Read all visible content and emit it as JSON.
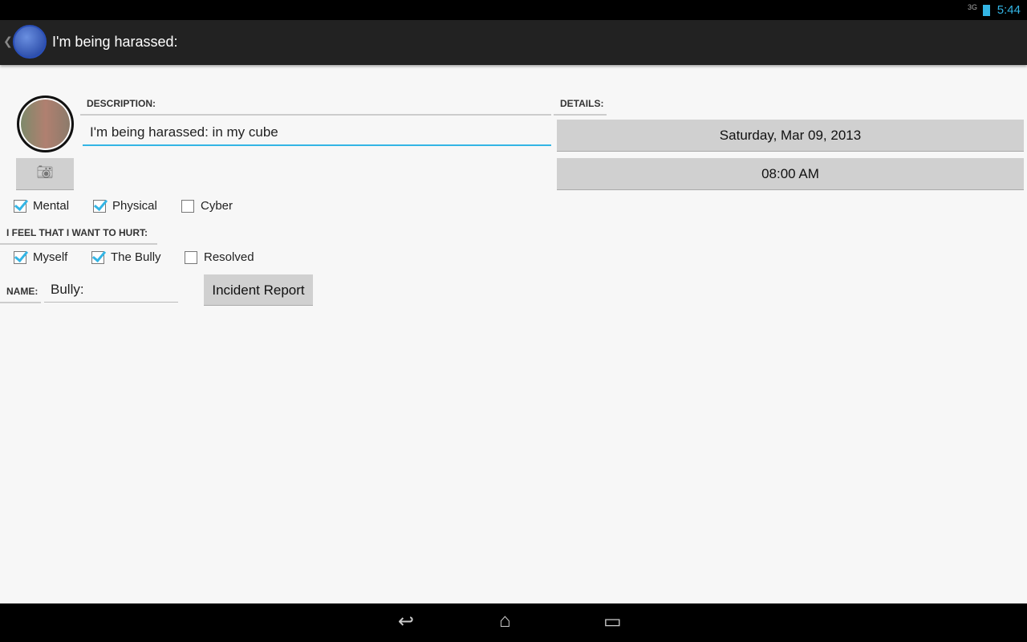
{
  "status_bar": {
    "network": "3G",
    "time": "5:44"
  },
  "action_bar": {
    "title": "I'm being harassed:"
  },
  "form": {
    "description_label": "DESCRIPTION:",
    "description_value": "I'm being harassed: in my cube",
    "details_label": "DETAILS:",
    "date": "Saturday, Mar 09, 2013",
    "time": "08:00 AM",
    "types": [
      {
        "label": "Mental",
        "checked": true
      },
      {
        "label": "Physical",
        "checked": true
      },
      {
        "label": "Cyber",
        "checked": false
      }
    ],
    "hurt_label": "I FEEL THAT I WANT TO HURT:",
    "hurt": [
      {
        "label": "Myself",
        "checked": true
      },
      {
        "label": "The Bully",
        "checked": true
      },
      {
        "label": "Resolved",
        "checked": false
      }
    ],
    "name_label": "NAME:",
    "name_value": "Bully:",
    "incident_report": "Incident Report"
  }
}
